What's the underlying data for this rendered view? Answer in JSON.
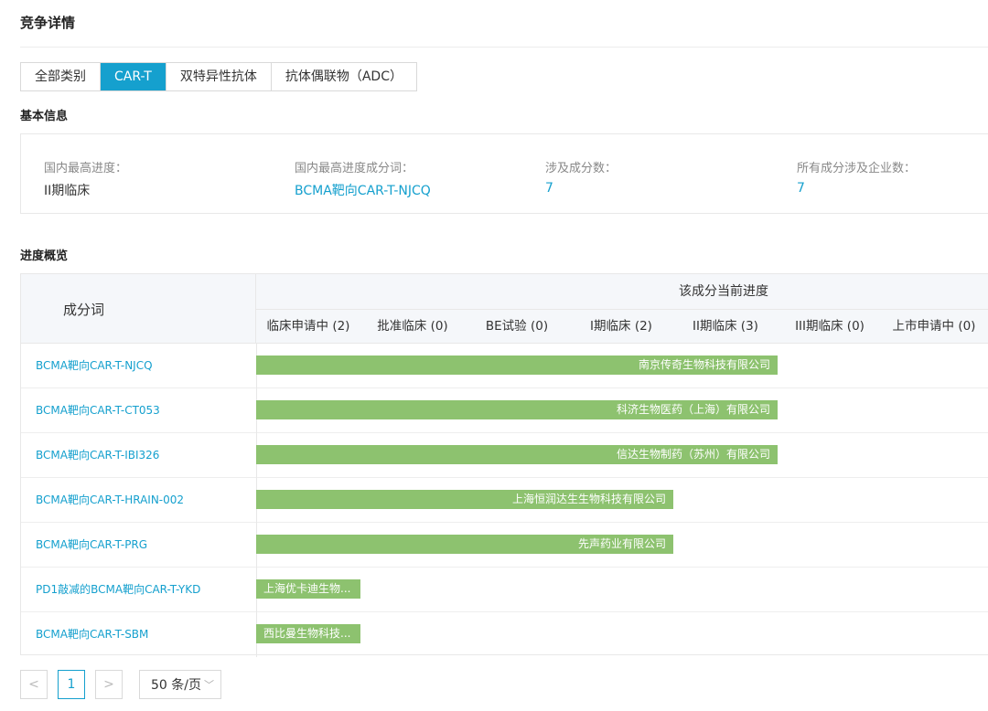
{
  "page": {
    "title": "竞争详情"
  },
  "tabs": [
    {
      "label": "全部类别",
      "active": false
    },
    {
      "label": "CAR-T",
      "active": true
    },
    {
      "label": "双特异性抗体",
      "active": false
    },
    {
      "label": "抗体偶联物（ADC）",
      "active": false
    }
  ],
  "basic_info": {
    "title": "基本信息",
    "fields": [
      {
        "label": "国内最高进度：",
        "value": "II期临床",
        "link": false
      },
      {
        "label": "国内最高进度成分词：",
        "value": "BCMA靶向CAR-T-NJCQ",
        "link": true
      },
      {
        "label": "涉及成分数：",
        "value": "7",
        "link": true
      },
      {
        "label": "所有成分涉及企业数：",
        "value": "7",
        "link": true
      }
    ]
  },
  "progress": {
    "title": "进度概览",
    "column_header": "成分词",
    "group_header": "该成分当前进度",
    "stages": [
      "临床申请中 (2)",
      "批准临床 (0)",
      "BE试验 (0)",
      "I期临床 (2)",
      "II期临床 (3)",
      "III期临床 (0)",
      "上市申请中 (0)"
    ],
    "rows": [
      {
        "name": "BCMA靶向CAR-T-NJCQ",
        "company": "南京传奇生物科技有限公司",
        "stage_reached": 5
      },
      {
        "name": "BCMA靶向CAR-T-CT053",
        "company": "科济生物医药（上海）有限公司",
        "stage_reached": 5
      },
      {
        "name": "BCMA靶向CAR-T-IBI326",
        "company": "信达生物制药（苏州）有限公司",
        "stage_reached": 5
      },
      {
        "name": "BCMA靶向CAR-T-HRAIN-002",
        "company": "上海恒润达生生物科技有限公司",
        "stage_reached": 4
      },
      {
        "name": "BCMA靶向CAR-T-PRG",
        "company": "先声药业有限公司",
        "stage_reached": 4
      },
      {
        "name": "PD1敲减的BCMA靶向CAR-T-YKD",
        "company": "上海优卡迪生物...",
        "stage_reached": 1
      },
      {
        "name": "BCMA靶向CAR-T-SBM",
        "company": "西比曼生物科技...",
        "stage_reached": 1
      }
    ]
  },
  "pagination": {
    "prev": "<",
    "current": "1",
    "next": ">",
    "page_size": "50 条/页"
  },
  "colors": {
    "accent": "#15a0ce",
    "bar": "#8dc26f"
  }
}
